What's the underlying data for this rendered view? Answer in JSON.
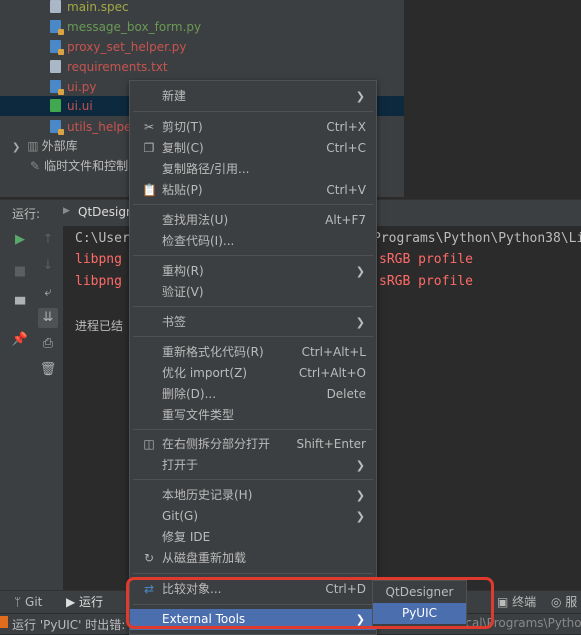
{
  "project_tree": {
    "files": [
      {
        "name": "main.spec",
        "color": "#a3a845",
        "icon": "text-file-icon"
      },
      {
        "name": "message_box_form.py",
        "color": "#6a9955",
        "icon": "python-file-icon"
      },
      {
        "name": "proxy_set_helper.py",
        "color": "#c75450",
        "icon": "python-file-icon"
      },
      {
        "name": "requirements.txt",
        "color": "#c75450",
        "icon": "text-file-icon"
      },
      {
        "name": "ui.py",
        "color": "#c75450",
        "icon": "python-file-icon"
      },
      {
        "name": "ui.ui",
        "color": "#c75450",
        "icon": "ui-file-icon"
      },
      {
        "name": "utils_helpe",
        "color": "#c75450",
        "icon": "python-file-icon"
      }
    ],
    "external_libs": "外部库",
    "scratches": "临时文件和控制"
  },
  "run_panel": {
    "label": "运行:",
    "tab": "QtDesign",
    "console": {
      "line1": "C:\\User",
      "line1_right": "Programs\\Python\\Python38\\Li",
      "line2a": "libpng",
      "line2b": "sRGB profile",
      "line3a": "libpng",
      "line3b": "sRGB profile",
      "exit": "进程已结"
    }
  },
  "tool_strip": {
    "git": "Git",
    "run": "运行",
    "terminal": "终端",
    "services": "服"
  },
  "status_bar": {
    "text": "运行 'PyUIC' 时出错:",
    "right": "ocal\\Programs\\Python"
  },
  "context_menu": {
    "items": [
      {
        "label": "新建",
        "shortcut": "",
        "submenu": true
      },
      {
        "label": "剪切(T)",
        "shortcut": "Ctrl+X",
        "icon": "scissors-icon"
      },
      {
        "label": "复制(C)",
        "shortcut": "Ctrl+C",
        "icon": "copy-icon"
      },
      {
        "label": "复制路径/引用...",
        "shortcut": ""
      },
      {
        "label": "粘贴(P)",
        "shortcut": "Ctrl+V",
        "icon": "paste-icon"
      },
      {
        "label": "查找用法(U)",
        "shortcut": "Alt+F7"
      },
      {
        "label": "检查代码(I)...",
        "shortcut": ""
      },
      {
        "label": "重构(R)",
        "shortcut": "",
        "submenu": true
      },
      {
        "label": "验证(V)",
        "shortcut": ""
      },
      {
        "label": "书签",
        "shortcut": "",
        "submenu": true
      },
      {
        "label": "重新格式化代码(R)",
        "shortcut": "Ctrl+Alt+L"
      },
      {
        "label": "优化 import(Z)",
        "shortcut": "Ctrl+Alt+O"
      },
      {
        "label": "删除(D)...",
        "shortcut": "Delete"
      },
      {
        "label": "重写文件类型",
        "shortcut": ""
      },
      {
        "label": "在右侧拆分部分打开",
        "shortcut": "Shift+Enter",
        "icon": "split-icon"
      },
      {
        "label": "打开于",
        "shortcut": "",
        "submenu": true
      },
      {
        "label": "本地历史记录(H)",
        "shortcut": "",
        "submenu": true
      },
      {
        "label": "Git(G)",
        "shortcut": "",
        "submenu": true
      },
      {
        "label": "修复 IDE",
        "shortcut": ""
      },
      {
        "label": "从磁盘重新加载",
        "shortcut": "",
        "icon": "reload-icon"
      },
      {
        "label": "比较对象...",
        "shortcut": "Ctrl+D",
        "icon": "compare-icon"
      },
      {
        "label": "External Tools",
        "shortcut": "",
        "submenu": true,
        "active": true
      }
    ]
  },
  "submenu": {
    "items": [
      {
        "label": "QtDesigner"
      },
      {
        "label": "PyUIC",
        "active": true
      }
    ]
  },
  "colors": {
    "accent": "#4b6eaf",
    "highlight_border": "#e03a2f",
    "error_text": "#ff6b68"
  }
}
